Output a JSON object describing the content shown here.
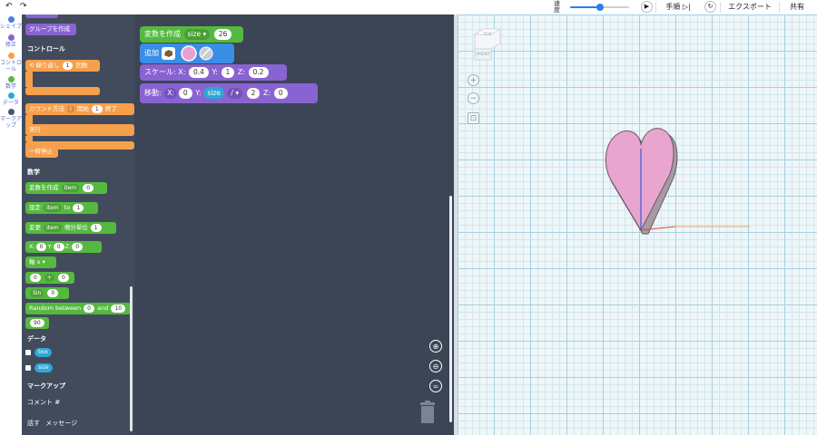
{
  "topbar": {
    "undo_icon": "undo-icon",
    "redo_icon": "redo-icon",
    "speed_label": "速度",
    "speed_level": 0.5,
    "play_icon": "play-icon",
    "step_label": "手順",
    "reset_icon": "reset-icon",
    "export_label": "エクスポート",
    "share_label": "共有"
  },
  "categories": [
    {
      "label": "シェイプ",
      "color": "#4a7fe3"
    },
    {
      "label": "修正",
      "color": "#8a63d2"
    },
    {
      "label": "コントロール",
      "color": "#f7a04c"
    },
    {
      "label": "数学",
      "color": "#56b93f"
    },
    {
      "label": "データ",
      "color": "#2ea7d6"
    },
    {
      "label": "マークアップ",
      "color": "#4a5568"
    }
  ],
  "palette": {
    "group_block": "グループを作成",
    "control_header": "コントロール",
    "repeat": {
      "label": "繰り返し",
      "count": "1",
      "unit": "回数"
    },
    "count_with": {
      "label": "カウント方法",
      "var": "i",
      "start_label": "開始",
      "start": "1",
      "end_label": "終了"
    },
    "do_label": "実行",
    "pause_label": "一時停止",
    "math_header": "数学",
    "create_var": {
      "label": "変数を作成",
      "var": "item",
      "value": "0"
    },
    "set_var": {
      "label": "設定",
      "var": "item",
      "to": "to",
      "value": "1"
    },
    "change_var": {
      "label": "変更",
      "var": "item",
      "by_label": "増分単位",
      "value": "1"
    },
    "xyz": {
      "x_label": "X:",
      "x": "0",
      "y_label": "Y:",
      "y": "0",
      "z_label": "Z:",
      "z": "0"
    },
    "axis": "軸 x",
    "arith": {
      "a": "0",
      "op": "+",
      "b": "0"
    },
    "sin": {
      "label": "Sin",
      "value": "0"
    },
    "random": {
      "label": "Random between",
      "a": "0",
      "and": "and",
      "b": "10"
    },
    "number": "90",
    "data_header": "データ",
    "vars": [
      "box",
      "size"
    ],
    "markup_header": "マークアップ",
    "comment_label": "コメント #",
    "say_label": "話す",
    "message_label": "メッセージ"
  },
  "workspace": {
    "create_var": {
      "label": "変数を作成",
      "var": "size",
      "value": "26"
    },
    "add_label": "追加",
    "scale": {
      "label": "スケール:",
      "x_label": "X:",
      "x": "0.4",
      "y_label": "Y:",
      "y": "1",
      "z_label": "Z:",
      "z": "0.2"
    },
    "move": {
      "label": "移動:",
      "x_label": "X:",
      "x": "0",
      "y_label": "Y:",
      "y_var": "size",
      "op": "/",
      "divisor": "2",
      "z_label": "Z:",
      "z": "0"
    },
    "zoom_in_icon": "zoom-in-icon",
    "zoom_out_icon": "zoom-out-icon",
    "reset_zoom_icon": "equals-icon",
    "trash_icon": "trash-icon"
  },
  "viewport": {
    "cube_top": "TOP",
    "cube_front": "FRONT",
    "zoom_in": "+",
    "zoom_out": "−",
    "fit_icon": "fit-view-icon",
    "shape_color": "#e7a5cf",
    "shape_edge": "#6b5a63",
    "axis_y_color": "#3d5bd9",
    "axis_x_color": "#f2a660",
    "axis_x_red": "#e0453a"
  }
}
